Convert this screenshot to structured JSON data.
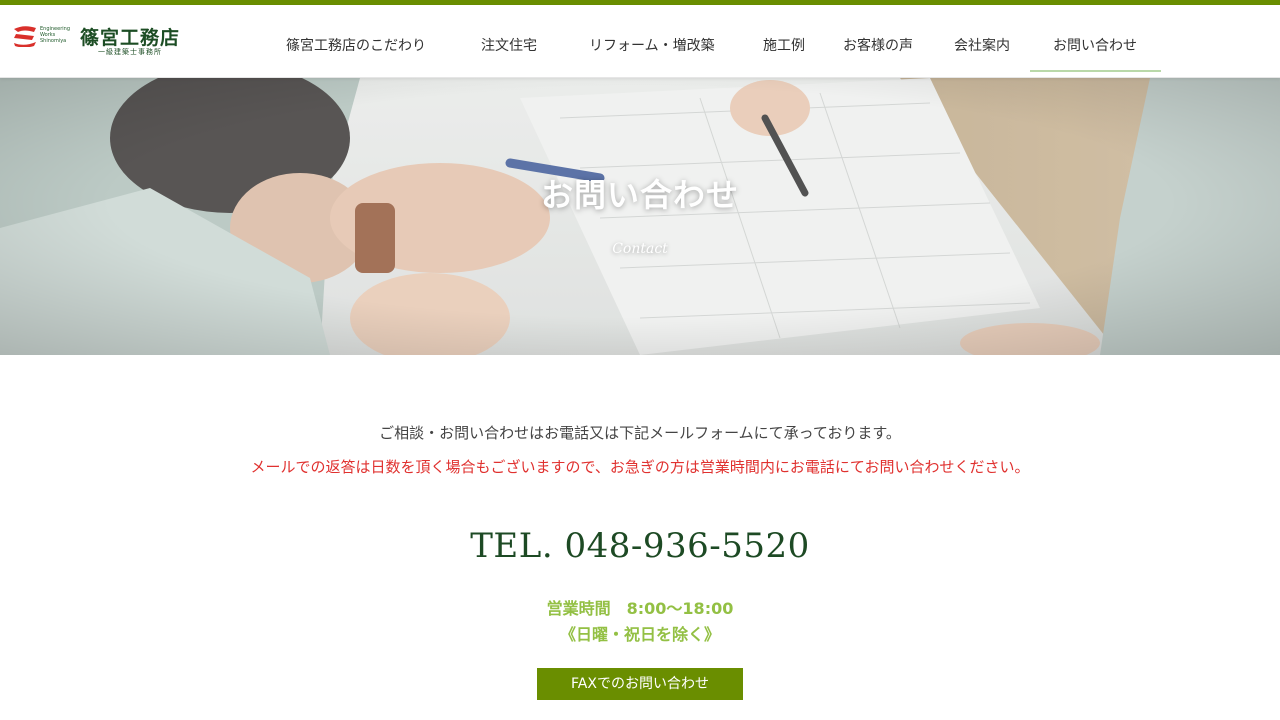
{
  "brand": {
    "mark_text": "S",
    "english_lines": [
      "Engineering",
      "Works",
      "Shinomiya"
    ],
    "name": "篠宮工務店",
    "sub": "一級建築士事務所",
    "colors": {
      "accent": "#6a8e00",
      "logo_red": "#d9302b",
      "logo_green": "#1c4d24"
    }
  },
  "nav": {
    "items": [
      {
        "label": "篠宮工務店のこだわり"
      },
      {
        "label": "注文住宅"
      },
      {
        "label": "リフォーム・増改築"
      },
      {
        "label": "施工例"
      },
      {
        "label": "お客様の声"
      },
      {
        "label": "会社案内"
      },
      {
        "label": "お問い合わせ",
        "active": true
      }
    ]
  },
  "hero": {
    "title": "お問い合わせ",
    "subtitle": "Contact"
  },
  "content": {
    "intro": "ご相談・お問い合わせはお電話又は下記メールフォームにて承っております。",
    "notice": "メールでの返答は日数を頂く場合もございますので、お急ぎの方は営業時間内にお電話にてお問い合わせください。",
    "tel": "TEL. 048-936-5520",
    "hours": "営業時間　8:00～18:00",
    "closed": "《日曜・祝日を除く》",
    "fax_button": "FAXでのお問い合わせ"
  },
  "colors": {
    "notice_red": "#e0312f",
    "tel_green": "#1d4a24",
    "hours_green": "#93c044",
    "button_green": "#6a8e00"
  }
}
